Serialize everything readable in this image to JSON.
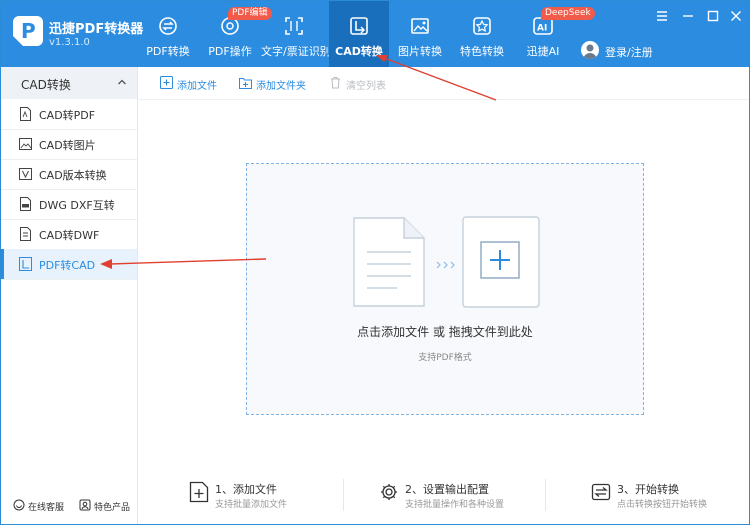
{
  "app": {
    "name": "迅捷PDF转换器",
    "version": "v1.3.1.0"
  },
  "nav": {
    "tabs": [
      {
        "label": "PDF转换",
        "icon": "pdf-convert-icon"
      },
      {
        "label": "PDF操作",
        "icon": "pdf-operate-icon",
        "badge": "PDF编辑"
      },
      {
        "label": "文字/票证识别",
        "icon": "ocr-icon"
      },
      {
        "label": "CAD转换",
        "icon": "cad-convert-icon",
        "active": true
      },
      {
        "label": "图片转换",
        "icon": "image-convert-icon"
      },
      {
        "label": "特色转换",
        "icon": "special-convert-icon"
      },
      {
        "label": "迅捷AI",
        "icon": "ai-icon",
        "badge": "DeepSeek"
      }
    ],
    "login": "登录/注册"
  },
  "sidebar": {
    "header": "CAD转换",
    "items": [
      {
        "label": "CAD转PDF",
        "icon": "pdf-file-icon"
      },
      {
        "label": "CAD转图片",
        "icon": "image-file-icon"
      },
      {
        "label": "CAD版本转换",
        "icon": "version-icon"
      },
      {
        "label": "DWG DXF互转",
        "icon": "dwg-file-icon"
      },
      {
        "label": "CAD转DWF",
        "icon": "dwf-file-icon"
      },
      {
        "label": "PDF转CAD",
        "icon": "cad-file-icon",
        "active": true
      }
    ],
    "footer": {
      "service": "在线客服",
      "features": "特色产品"
    }
  },
  "toolbar": {
    "add_file": "添加文件",
    "add_folder": "添加文件夹",
    "clear_list": "清空列表"
  },
  "dropzone": {
    "main": "点击添加文件 或 拖拽文件到此处",
    "sub": "支持PDF格式"
  },
  "steps": [
    {
      "title": "1、添加文件",
      "desc": "支持批量添加文件"
    },
    {
      "title": "2、设置输出配置",
      "desc": "支持批量操作和各种设置"
    },
    {
      "title": "3、开始转换",
      "desc": "点击转换按钮开始转换"
    }
  ],
  "colors": {
    "primary": "#2b8ce0",
    "active_tab": "#1a6fbd",
    "badge": "#f25a4a",
    "annotation_arrow": "#e0402f"
  }
}
